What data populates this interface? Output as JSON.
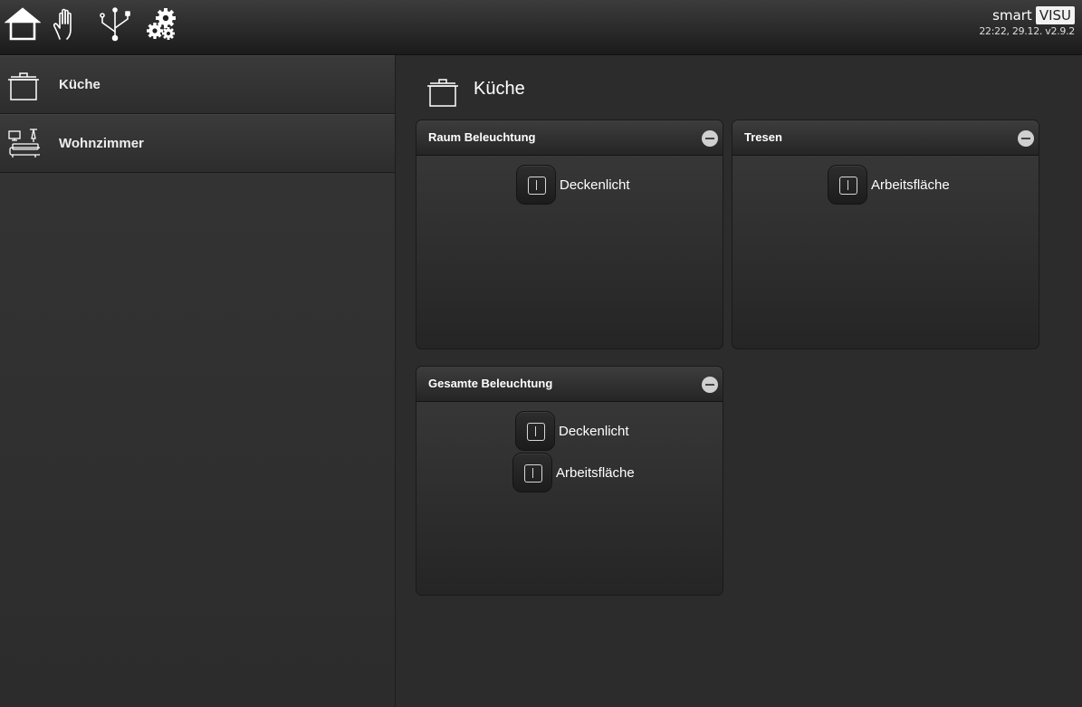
{
  "header": {
    "icons": [
      "home-icon",
      "hand-icon",
      "network-icon",
      "gears-icon"
    ],
    "brand_smart": "smart",
    "brand_visu": "VISU",
    "status": "22:22, 29.12. v2.9.2"
  },
  "sidebar": {
    "items": [
      {
        "label": "Küche",
        "icon": "pot-icon"
      },
      {
        "label": "Wohnzimmer",
        "icon": "living-room-icon"
      }
    ]
  },
  "main": {
    "title": "Küche",
    "icon": "pot-icon",
    "blocks": [
      {
        "title": "Raum Beleuchtung",
        "switches": [
          {
            "label": "Deckenlicht"
          }
        ]
      },
      {
        "title": "Tresen",
        "switches": [
          {
            "label": "Arbeitsfläche"
          }
        ]
      },
      {
        "title": "Gesamte Beleuchtung",
        "switches": [
          {
            "label": "Deckenlicht"
          },
          {
            "label": "Arbeitsfläche"
          }
        ]
      }
    ]
  }
}
